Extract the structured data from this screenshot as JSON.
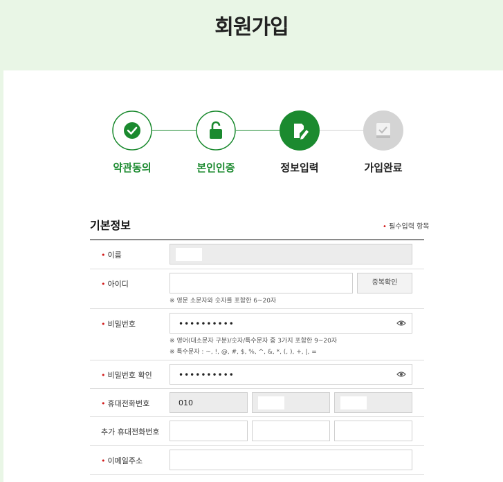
{
  "header": {
    "title": "회원가입"
  },
  "steps": [
    {
      "label": "약관동의",
      "icon": "check-icon",
      "state": "done",
      "color": "#1b8a2f"
    },
    {
      "label": "본인인증",
      "icon": "lock-icon",
      "state": "done",
      "color": "#1b8a2f"
    },
    {
      "label": "정보입력",
      "icon": "edit-icon",
      "state": "active",
      "color": "#1b8a2f"
    },
    {
      "label": "가입완료",
      "icon": "document-icon",
      "state": "pending",
      "color": "#cccccc"
    }
  ],
  "form": {
    "section_title": "기본정보",
    "required_note": "필수입력 항목",
    "required_mark": "•",
    "fields": {
      "name": {
        "label": "이름"
      },
      "user_id": {
        "label": "아이디",
        "button": "중복확인",
        "hint": "※ 영문 소문자와 숫자를 포함한 6~20자"
      },
      "password": {
        "label": "비밀번호",
        "value": "••••••••••",
        "hint1": "※ 영어(대소문자 구분)/숫자/특수문자 중 3가지 포함한 9~20자",
        "hint2": "※ 특수문자 : ~, !, @, #, $, %, ^, &, *, (, ), +, |, ="
      },
      "password_confirm": {
        "label": "비밀번호 확인",
        "value": "••••••••••"
      },
      "mobile": {
        "label": "휴대전화번호",
        "prefix": "010"
      },
      "extra_mobile": {
        "label": "추가 휴대전화번호"
      },
      "email": {
        "label": "이메일주소"
      }
    }
  },
  "colors": {
    "brand_green": "#1b8a2f",
    "required_red": "#d21a1a",
    "header_bg": "#e9f6e6"
  }
}
